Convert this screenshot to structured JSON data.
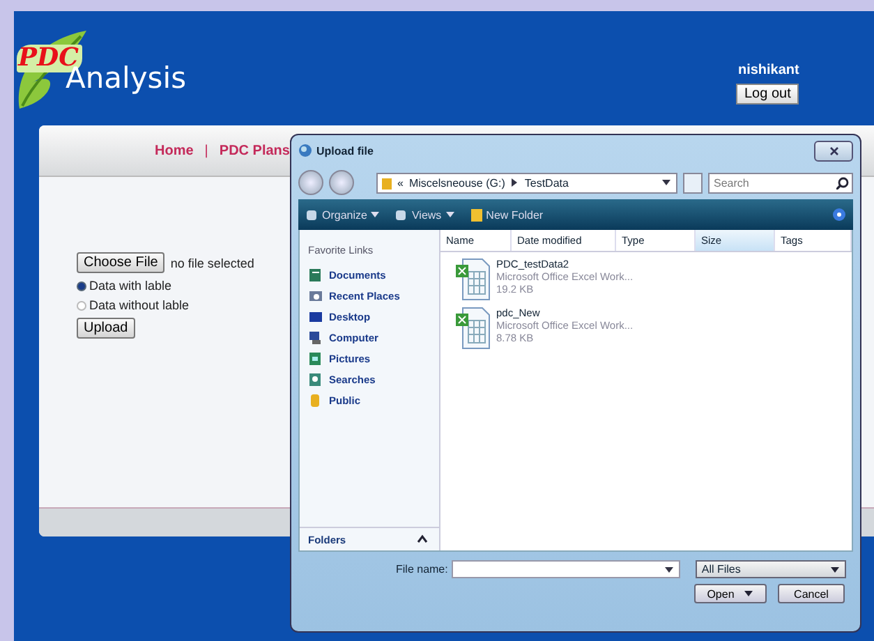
{
  "header": {
    "logo_mark": "PDC",
    "logo_text": "Analysis",
    "user": "nishikant",
    "logout_button": "Log out"
  },
  "nav": {
    "separator": "|",
    "items": [
      {
        "label": "Home"
      },
      {
        "label": "PDC Plans"
      }
    ]
  },
  "upload_form": {
    "choose_button": "Choose File",
    "file_status": "no file selected",
    "upload_button": "Upload",
    "options": [
      {
        "label": "Data with lable",
        "selected": true
      },
      {
        "label": "Data without lable",
        "selected": false
      }
    ]
  },
  "dialog": {
    "title": "Upload file",
    "address": {
      "prefix": "«",
      "path": [
        "Miscelsneouse (G:)",
        "TestData"
      ]
    },
    "search": {
      "placeholder": "Search"
    },
    "toolbar": [
      {
        "label": "Organize",
        "menu": true
      },
      {
        "label": "Views",
        "menu": true
      },
      {
        "label": "New Folder",
        "menu": false
      }
    ],
    "favorites": {
      "title": "Favorite Links",
      "items": [
        {
          "label": "Documents",
          "kind": "documents"
        },
        {
          "label": "Recent Places",
          "kind": "recent"
        },
        {
          "label": "Desktop",
          "kind": "desktop"
        },
        {
          "label": "Computer",
          "kind": "computer"
        },
        {
          "label": "Pictures",
          "kind": "pictures"
        },
        {
          "label": "Searches",
          "kind": "searches"
        },
        {
          "label": "Public",
          "kind": "public"
        }
      ]
    },
    "folders": "Folders",
    "columns": [
      {
        "label": "Name",
        "selected": false
      },
      {
        "label": "Date modified",
        "selected": false
      },
      {
        "label": "Type",
        "selected": false
      },
      {
        "label": "Size",
        "selected": true
      },
      {
        "label": "Tags",
        "selected": false
      }
    ],
    "files": [
      {
        "name": "PDC_testData2",
        "type": "Microsoft Office Excel Work...",
        "size": "19.2 KB"
      },
      {
        "name": "pdc_New",
        "type": "Microsoft Office Excel Work...",
        "size": "8.78 KB"
      }
    ],
    "file_name_label": "File name:",
    "file_type": "All Files",
    "open_button": "Open",
    "cancel_button": "Cancel"
  }
}
